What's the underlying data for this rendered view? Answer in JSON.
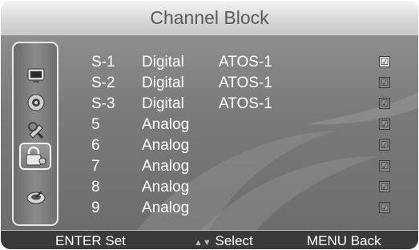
{
  "title": "Channel Block",
  "sidebar": {
    "icons": [
      "tv-icon",
      "speaker-icon",
      "settings-icon",
      "lock-icon",
      "satellite-icon"
    ],
    "active": "lock-icon"
  },
  "channels": [
    {
      "number": "S-1",
      "type": "Digital",
      "name": "ATOS-1",
      "check": "☑"
    },
    {
      "number": "S-2",
      "type": "Digital",
      "name": "ATOS-1",
      "check": "☑"
    },
    {
      "number": "S-3",
      "type": "Digital",
      "name": "ATOS-1",
      "check": "☑"
    },
    {
      "number": "5",
      "type": "Analog",
      "name": "",
      "check": "☑"
    },
    {
      "number": "6",
      "type": "Analog",
      "name": "",
      "check": "☑"
    },
    {
      "number": "7",
      "type": "Analog",
      "name": "",
      "check": "☑"
    },
    {
      "number": "8",
      "type": "Analog",
      "name": "",
      "check": "☑"
    },
    {
      "number": "9",
      "type": "Analog",
      "name": "",
      "check": "☑"
    }
  ],
  "footer": {
    "enter_key": "ENTER",
    "enter_label": "Set",
    "arrows": "▲▼",
    "select_label": "Select",
    "menu_key": "MENU",
    "back_label": "Back"
  }
}
